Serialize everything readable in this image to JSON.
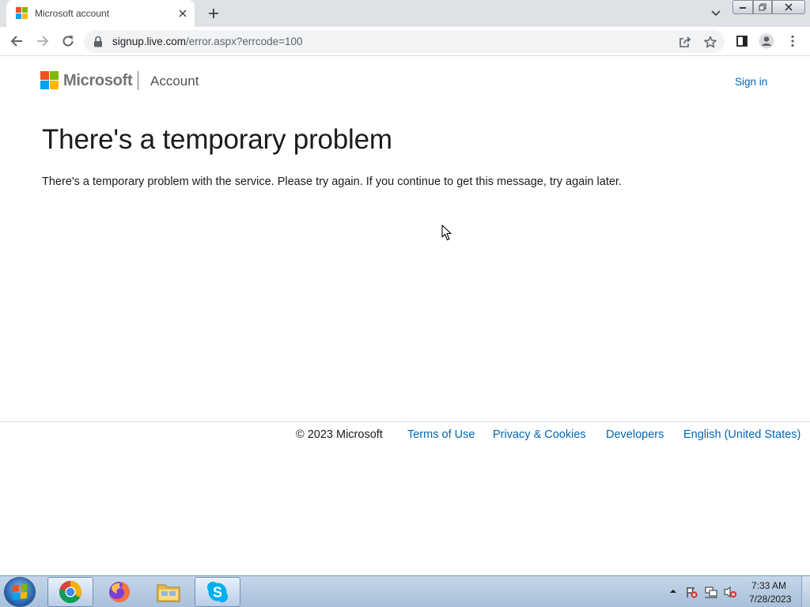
{
  "browser": {
    "tab": {
      "title": "Microsoft account"
    },
    "address": {
      "host": "signup.live.com",
      "path": "/error.aspx?errcode=100"
    }
  },
  "header": {
    "brand": "Microsoft",
    "section": "Account",
    "signin": "Sign in"
  },
  "main": {
    "title": "There's a temporary problem",
    "message": "There's a temporary problem with the service. Please try again. If you continue to get this message, try again later."
  },
  "footer": {
    "copyright": "© 2023 Microsoft",
    "links": [
      "Terms of Use",
      "Privacy & Cookies",
      "Developers",
      "English (United States)"
    ]
  },
  "taskbar": {
    "apps": [
      "chrome-icon",
      "firefox-icon",
      "file-explorer-icon",
      "skype-icon"
    ],
    "clock": {
      "time": "7:33 AM",
      "date": "7/28/2023"
    }
  },
  "colors": {
    "link": "#0067b8",
    "ms_red": "#f25022",
    "ms_green": "#7fba00",
    "ms_blue": "#00a4ef",
    "ms_yellow": "#ffb900"
  }
}
